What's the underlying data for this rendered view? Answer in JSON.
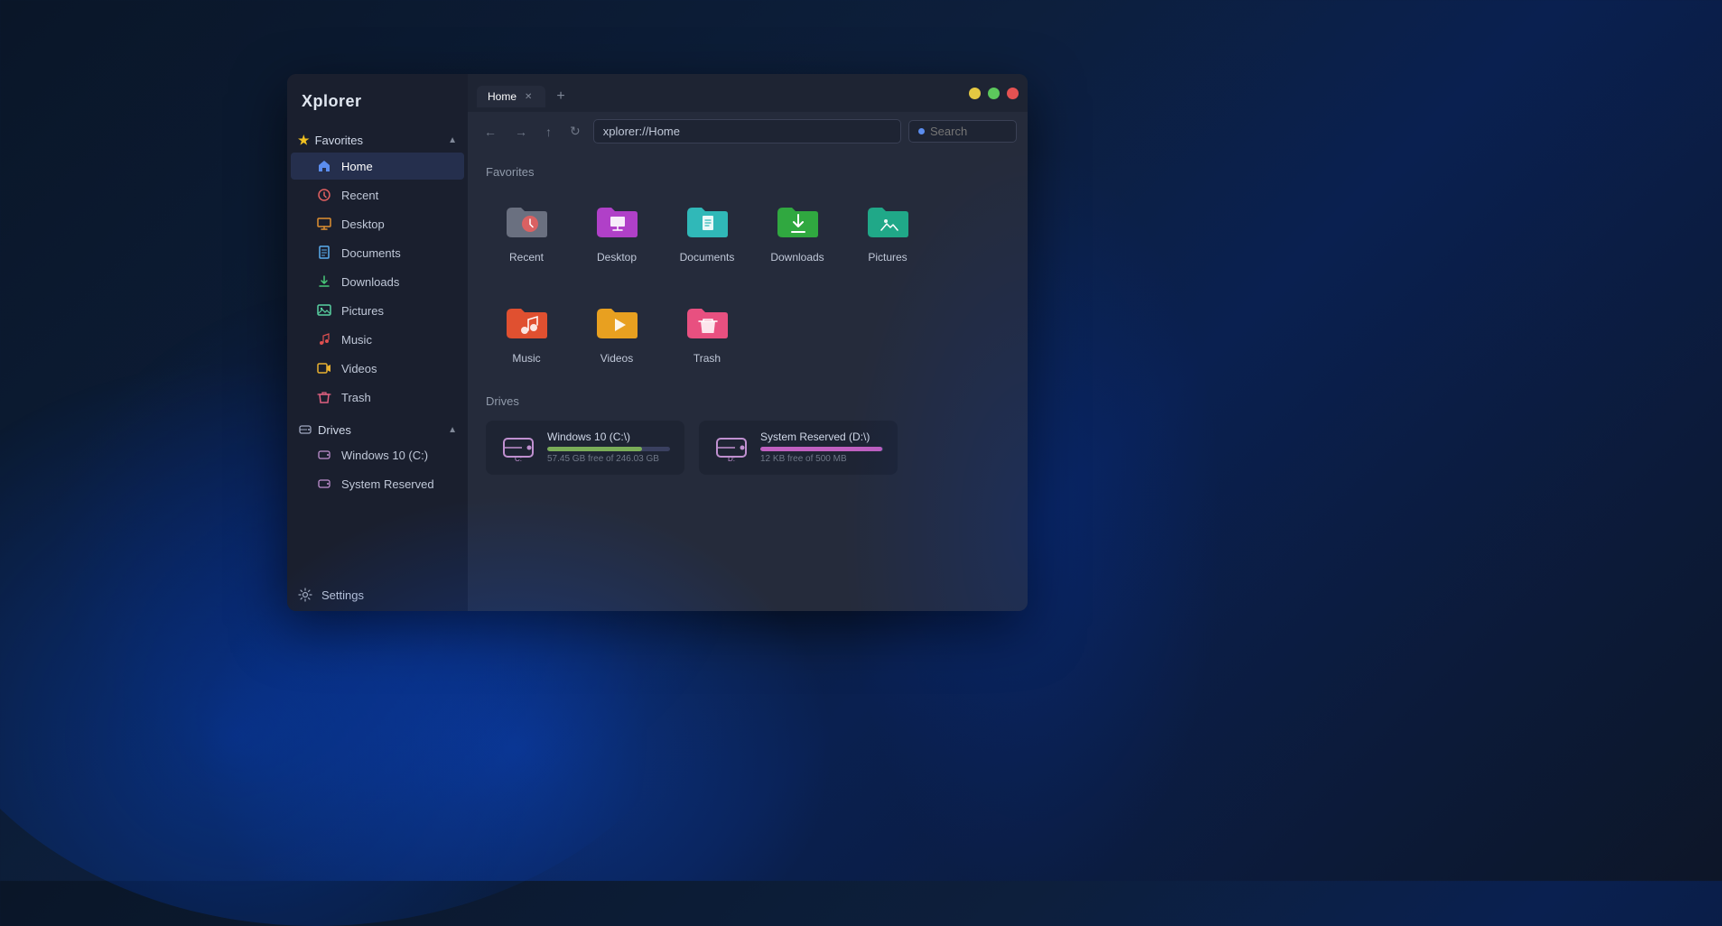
{
  "app": {
    "title": "Xplorer"
  },
  "window_controls": {
    "minimize_color": "#e5c842",
    "maximize_color": "#5cc85c",
    "close_color": "#e55252"
  },
  "tabs": [
    {
      "label": "Home",
      "active": true
    }
  ],
  "tab_add_label": "+",
  "toolbar": {
    "back_icon": "←",
    "forward_icon": "→",
    "up_icon": "↑",
    "refresh_icon": "↻",
    "address": "xplorer://Home",
    "search_placeholder": "Search"
  },
  "favorites_section": {
    "label": "Favorites",
    "icon": "★",
    "chevron": "▲"
  },
  "sidebar_favorites": [
    {
      "key": "home",
      "label": "Home",
      "color": "#5b8def"
    },
    {
      "key": "recent",
      "label": "Recent",
      "color": "#e06060"
    },
    {
      "key": "desktop",
      "label": "Desktop",
      "color": "#e09030"
    },
    {
      "key": "documents",
      "label": "Documents",
      "color": "#5badef"
    },
    {
      "key": "downloads",
      "label": "Downloads",
      "color": "#48c878"
    },
    {
      "key": "pictures",
      "label": "Pictures",
      "color": "#58d0a0"
    },
    {
      "key": "music",
      "label": "Music",
      "color": "#e05050"
    },
    {
      "key": "videos",
      "label": "Videos",
      "color": "#e8b030"
    },
    {
      "key": "trash",
      "label": "Trash",
      "color": "#e06080"
    }
  ],
  "drives_section": {
    "label": "Drives",
    "chevron": "▲"
  },
  "sidebar_drives": [
    {
      "key": "win10c",
      "label": "Windows 10 (C:)"
    },
    {
      "key": "sysreserved",
      "label": "System Reserved"
    }
  ],
  "settings_label": "Settings",
  "main_section_favorites": "Favorites",
  "main_section_drives": "Drives",
  "folder_items": [
    {
      "key": "recent",
      "label": "Recent",
      "folder_color": "#6a7080",
      "badge_color": "#e06060",
      "badge_icon": "🕐"
    },
    {
      "key": "desktop",
      "label": "Desktop",
      "folder_color": "#b040c8",
      "badge_color": "#b040c8",
      "badge_icon": "🖥"
    },
    {
      "key": "documents",
      "label": "Documents",
      "folder_color": "#30b8b8",
      "badge_color": "#30b8b8",
      "badge_icon": "📄"
    },
    {
      "key": "downloads",
      "label": "Downloads",
      "folder_color": "#30a840",
      "badge_color": "#30a840",
      "badge_icon": "⬇"
    },
    {
      "key": "pictures",
      "label": "Pictures",
      "folder_color": "#20a888",
      "badge_color": "#20a888",
      "badge_icon": "🖼"
    }
  ],
  "folder_items_row2": [
    {
      "key": "music",
      "label": "Music",
      "folder_color": "#e05030",
      "badge_color": "#e05030",
      "badge_icon": "♪"
    },
    {
      "key": "videos",
      "label": "Videos",
      "folder_color": "#e8a020",
      "badge_color": "#e8a020",
      "badge_icon": "▶"
    },
    {
      "key": "trash",
      "label": "Trash",
      "folder_color": "#e85080",
      "badge_color": "#e85080",
      "badge_icon": "🗑"
    }
  ],
  "drives": [
    {
      "key": "win10c",
      "name": "Windows 10 (C:\\)",
      "free": "57.45 GB free of 246.03 GB",
      "fill_percent": 77,
      "bar_color": "#7aad58"
    },
    {
      "key": "sysreserved",
      "name": "System Reserved (D:\\)",
      "free": "12 KB free of 500 MB",
      "fill_percent": 99,
      "bar_color": "#c060c0"
    }
  ]
}
